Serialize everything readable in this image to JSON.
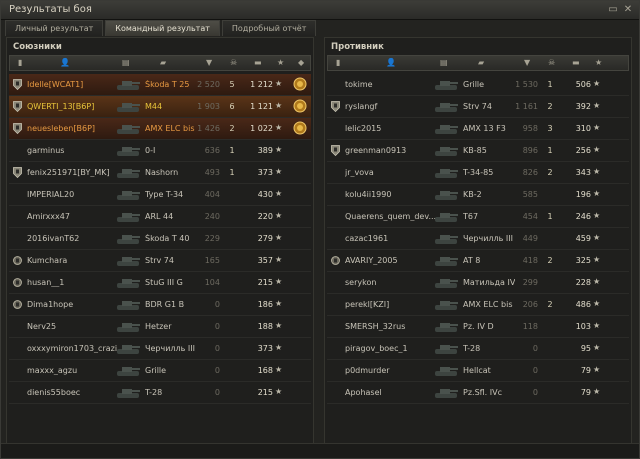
{
  "window": {
    "title": "Результаты боя"
  },
  "tabs": [
    {
      "label": "Личный результат",
      "active": false
    },
    {
      "label": "Командный результат",
      "active": true
    },
    {
      "label": "Подробный отчёт",
      "active": false
    }
  ],
  "allies": {
    "title": "Союзники",
    "rows": [
      {
        "name": "Idelle[WCAT1]",
        "vehicle": "Škoda T 25",
        "damage": "2 520",
        "kills": "5",
        "xp": "1 212",
        "style": "hl",
        "nameColor": "orange",
        "vehColor": "orange",
        "icon": "shield",
        "medal": true
      },
      {
        "name": "QWERTI_13[B6P]",
        "vehicle": "M44",
        "damage": "1 903",
        "kills": "6",
        "xp": "1 121",
        "style": "me",
        "nameColor": "yellow",
        "vehColor": "yellow",
        "icon": "shield",
        "medal": true
      },
      {
        "name": "neuesleben[B6P]",
        "vehicle": "AMX ELC bis",
        "damage": "1 426",
        "kills": "2",
        "xp": "1 022",
        "style": "hl",
        "nameColor": "orange",
        "vehColor": "orange",
        "icon": "shield",
        "medal": true
      },
      {
        "name": "garminus",
        "vehicle": "0-I",
        "damage": "636",
        "kills": "1",
        "xp": "389",
        "style": "",
        "nameColor": "",
        "vehColor": "",
        "icon": "",
        "medal": false
      },
      {
        "name": "fenix251971[BY_MK]",
        "vehicle": "Nashorn",
        "damage": "493",
        "kills": "1",
        "xp": "373",
        "style": "",
        "nameColor": "",
        "vehColor": "",
        "icon": "shield",
        "medal": false
      },
      {
        "name": "IMPERIAL20",
        "vehicle": "Type T-34",
        "damage": "404",
        "kills": "",
        "xp": "430",
        "style": "",
        "nameColor": "",
        "vehColor": "",
        "icon": "",
        "medal": false
      },
      {
        "name": "Amirxxx47",
        "vehicle": "ARL 44",
        "damage": "240",
        "kills": "",
        "xp": "220",
        "style": "",
        "nameColor": "",
        "vehColor": "",
        "icon": "",
        "medal": false
      },
      {
        "name": "2016ivanT62",
        "vehicle": "Škoda T 40",
        "damage": "229",
        "kills": "",
        "xp": "279",
        "style": "",
        "nameColor": "",
        "vehColor": "",
        "icon": "",
        "medal": false
      },
      {
        "name": "Kumchara",
        "vehicle": "Strv 74",
        "damage": "165",
        "kills": "",
        "xp": "357",
        "style": "",
        "nameColor": "",
        "vehColor": "",
        "icon": "medal",
        "medal": false
      },
      {
        "name": "husan__1",
        "vehicle": "StuG III G",
        "damage": "104",
        "kills": "",
        "xp": "215",
        "style": "",
        "nameColor": "",
        "vehColor": "",
        "icon": "medal",
        "medal": false
      },
      {
        "name": "Dima1hope",
        "vehicle": "BDR G1 B",
        "damage": "0",
        "kills": "",
        "xp": "186",
        "style": "",
        "nameColor": "",
        "vehColor": "",
        "icon": "medal",
        "medal": false
      },
      {
        "name": "Nerv25",
        "vehicle": "Hetzer",
        "damage": "0",
        "kills": "",
        "xp": "188",
        "style": "",
        "nameColor": "",
        "vehColor": "",
        "icon": "",
        "medal": false
      },
      {
        "name": "oxxxymiron1703_crazi",
        "vehicle": "Черчилль III",
        "damage": "0",
        "kills": "",
        "xp": "373",
        "style": "",
        "nameColor": "",
        "vehColor": "",
        "icon": "",
        "medal": false
      },
      {
        "name": "maxxx_agzu",
        "vehicle": "Grille",
        "damage": "0",
        "kills": "",
        "xp": "168",
        "style": "",
        "nameColor": "",
        "vehColor": "",
        "icon": "",
        "medal": false
      },
      {
        "name": "dienis55boec",
        "vehicle": "T-28",
        "damage": "0",
        "kills": "",
        "xp": "215",
        "style": "",
        "nameColor": "",
        "vehColor": "",
        "icon": "",
        "medal": false
      }
    ]
  },
  "enemies": {
    "title": "Противник",
    "rows": [
      {
        "name": "tokime",
        "vehicle": "Grille",
        "damage": "1 530",
        "kills": "1",
        "xp": "506",
        "icon": ""
      },
      {
        "name": "ryslangf",
        "vehicle": "Strv 74",
        "damage": "1 161",
        "kills": "2",
        "xp": "392",
        "icon": "shield"
      },
      {
        "name": "lelic2015",
        "vehicle": "AMX 13 F3",
        "damage": "958",
        "kills": "3",
        "xp": "310",
        "icon": ""
      },
      {
        "name": "greenman0913",
        "vehicle": "KB-85",
        "damage": "896",
        "kills": "1",
        "xp": "256",
        "icon": "shield"
      },
      {
        "name": "jr_vova",
        "vehicle": "T-34-85",
        "damage": "826",
        "kills": "2",
        "xp": "343",
        "icon": ""
      },
      {
        "name": "kolu4ii1990",
        "vehicle": "KB-2",
        "damage": "585",
        "kills": "",
        "xp": "196",
        "icon": ""
      },
      {
        "name": "Quaerens_quem_dev...",
        "vehicle": "T67",
        "damage": "454",
        "kills": "1",
        "xp": "246",
        "icon": ""
      },
      {
        "name": "cazac1961",
        "vehicle": "Черчилль III",
        "damage": "449",
        "kills": "",
        "xp": "459",
        "icon": ""
      },
      {
        "name": "AVARIY_2005",
        "vehicle": "AT 8",
        "damage": "418",
        "kills": "2",
        "xp": "325",
        "icon": "medal"
      },
      {
        "name": "serykon",
        "vehicle": "Матильда IV",
        "damage": "299",
        "kills": "",
        "xp": "228",
        "icon": ""
      },
      {
        "name": "perekl[KZI]",
        "vehicle": "AMX ELC bis",
        "damage": "206",
        "kills": "2",
        "xp": "486",
        "icon": ""
      },
      {
        "name": "SMERSH_32rus",
        "vehicle": "Pz. IV D",
        "damage": "118",
        "kills": "",
        "xp": "103",
        "icon": ""
      },
      {
        "name": "piragov_boec_1",
        "vehicle": "T-28",
        "damage": "0",
        "kills": "",
        "xp": "95",
        "icon": ""
      },
      {
        "name": "p0dmurder",
        "vehicle": "Hellcat",
        "damage": "0",
        "kills": "",
        "xp": "79",
        "icon": ""
      },
      {
        "name": "Apohasel",
        "vehicle": "Pz.Sfl. IVc",
        "damage": "0",
        "kills": "",
        "xp": "79",
        "icon": ""
      }
    ]
  }
}
